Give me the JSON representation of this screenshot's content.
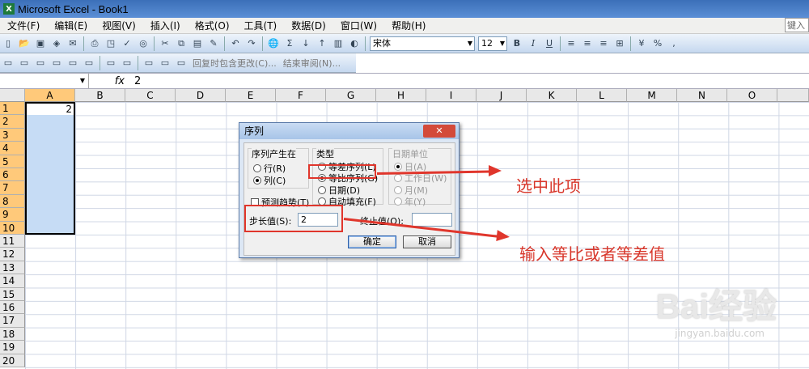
{
  "window": {
    "title": "Microsoft Excel - Book1",
    "app_icon": "excel-icon"
  },
  "menu": [
    "文件(F)",
    "编辑(E)",
    "视图(V)",
    "插入(I)",
    "格式(O)",
    "工具(T)",
    "数据(D)",
    "窗口(W)",
    "帮助(H)"
  ],
  "help_box": "键入",
  "toolbar": {
    "font_name": "宋体",
    "font_size": "12",
    "bold": "B",
    "italic": "I",
    "underline": "U",
    "percent": "%",
    "comma": ","
  },
  "review_toolbar": {
    "reply_label": "回复时包含更改(C)...",
    "end_review": "结束审阅(N)..."
  },
  "formula_bar": {
    "fx": "fx",
    "value": "2"
  },
  "columns": [
    "A",
    "B",
    "C",
    "D",
    "E",
    "F",
    "G",
    "H",
    "I",
    "J",
    "K",
    "L",
    "M",
    "N",
    "O"
  ],
  "rows": [
    "1",
    "2",
    "3",
    "4",
    "5",
    "6",
    "7",
    "8",
    "9",
    "10",
    "11",
    "12",
    "13",
    "14",
    "15",
    "16",
    "17",
    "18",
    "19",
    "20"
  ],
  "cell_a1": "2",
  "dialog": {
    "title": "序列",
    "close_label": "✕",
    "series_in": {
      "label": "序列产生在",
      "row": "行(R)",
      "col": "列(C)"
    },
    "type": {
      "label": "类型",
      "linear": "等差序列(L)",
      "growth": "等比序列(G)",
      "date": "日期(D)",
      "autofill": "自动填充(F)"
    },
    "date_unit": {
      "label": "日期单位",
      "day": "日(A)",
      "weekday": "工作日(W)",
      "month": "月(M)",
      "year": "年(Y)"
    },
    "trend": "预测趋势(T)",
    "step_label": "步长值(S):",
    "step_value": "2",
    "stop_label": "终止值(O):",
    "stop_value": "",
    "ok": "确定",
    "cancel": "取消"
  },
  "annotations": {
    "select_option": "选中此项",
    "enter_value": "输入等比或者等差值"
  },
  "watermark": {
    "brand": "Bai经验",
    "url": "jingyan.baidu.com"
  },
  "colors": {
    "annotation": "#e0362c",
    "selection": "#c6dcf5"
  }
}
